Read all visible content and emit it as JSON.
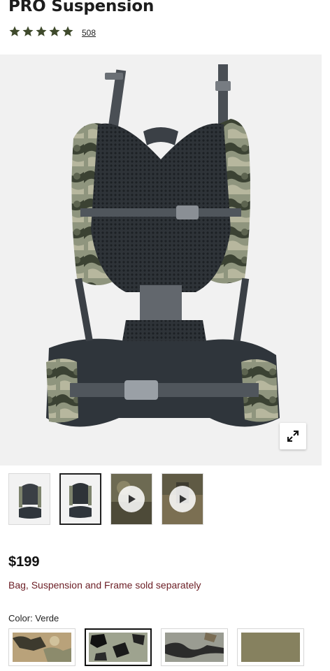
{
  "product": {
    "title": "PRO Suspension",
    "rating_stars": 5,
    "review_count": "508",
    "price": "$199",
    "note": "Bag, Suspension and Frame sold separately",
    "color_label": "Color: Verde",
    "star_color": "#3f4a2c"
  },
  "gallery": {
    "thumbnails": [
      {
        "type": "image",
        "selected": false
      },
      {
        "type": "image",
        "selected": true
      },
      {
        "type": "video",
        "selected": false
      },
      {
        "type": "video",
        "selected": false
      }
    ],
    "expand_icon": "expand-arrows-icon"
  },
  "swatches": [
    {
      "name": "camo-tan",
      "selected": false
    },
    {
      "name": "verde-camo",
      "selected": true
    },
    {
      "name": "camo-grey",
      "selected": false
    },
    {
      "name": "olive-solid",
      "selected": false
    }
  ]
}
